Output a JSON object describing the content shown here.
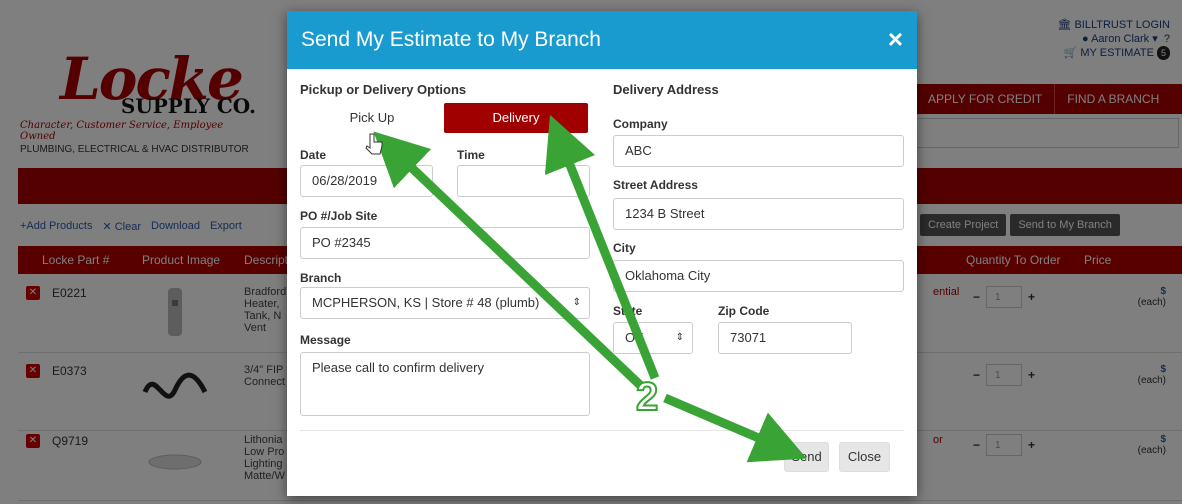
{
  "header": {
    "billtrust_login": "BILLTRUST LOGIN",
    "user_name": "Aaron Clark",
    "my_estimate": "MY ESTIMATE",
    "estimate_count": "5",
    "nav_apply_credit": "APPLY FOR CREDIT",
    "nav_find_branch": "FIND A BRANCH"
  },
  "logo": {
    "name": "Locke",
    "supply": "SUPPLY CO.",
    "tagline": "Character, Customer Service, Employee Owned",
    "subtitle": "PLUMBING, ELECTRICAL & HVAC DISTRIBUTOR"
  },
  "toolbar": {
    "add_products": "+Add Products",
    "clear": "✕ Clear",
    "download": "Download",
    "export": "Export",
    "create_project": "Create Project",
    "send_to_branch": "Send to My Branch"
  },
  "table": {
    "headers": [
      "Locke Part #",
      "Product Image",
      "Descript",
      "Quantity To Order",
      "Price"
    ],
    "rows": [
      {
        "part": "E0221",
        "desc": "Bradford Heater, Tank, N Vent",
        "avail": "ential",
        "qty": "1",
        "price_unit": "(each)"
      },
      {
        "part": "E0373",
        "desc": "3/4\" FIP Connect",
        "avail": "",
        "qty": "1",
        "price_unit": "(each)"
      },
      {
        "part": "Q9719",
        "desc": "Lithonia Low Pro Lighting Matte/W",
        "avail": "or",
        "qty": "1",
        "price_unit": "(each)"
      }
    ]
  },
  "modal": {
    "title": "Send My Estimate to My Branch",
    "close_icon": "×",
    "pickup_section": "Pickup or Delivery Options",
    "tab_pickup": "Pick Up",
    "tab_delivery": "Delivery",
    "date_label": "Date",
    "date_value": "06/28/2019",
    "time_label": "Time",
    "time_value": "",
    "po_label": "PO #/Job Site",
    "po_value": "PO #2345",
    "branch_label": "Branch",
    "branch_value": "MCPHERSON, KS | Store # 48 (plumb)",
    "message_label": "Message",
    "message_value": "Please call to confirm delivery",
    "delivery_section": "Delivery Address",
    "company_label": "Company",
    "company_value": "ABC",
    "street_label": "Street Address",
    "street_value": "1234 B Street",
    "city_label": "City",
    "city_value": "Oklahoma City",
    "state_label": "State",
    "state_value": "OK",
    "zip_label": "Zip Code",
    "zip_value": "73071",
    "send_button": "Send",
    "close_button": "Close"
  },
  "annotation": {
    "step_number": "2",
    "arrow_color": "#3aa335"
  }
}
